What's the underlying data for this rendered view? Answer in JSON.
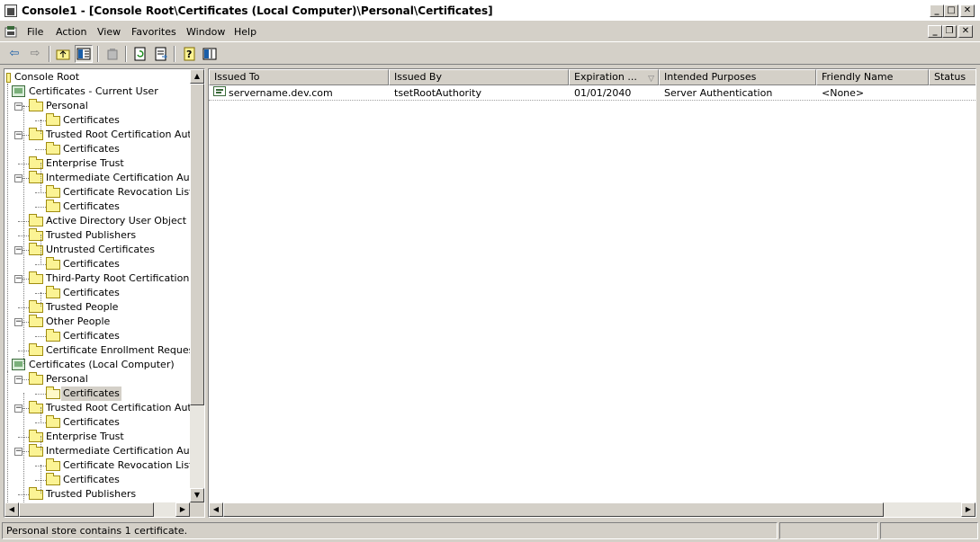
{
  "window": {
    "title": "Console1 - [Console Root\\Certificates (Local Computer)\\Personal\\Certificates]"
  },
  "menubar": {
    "items": [
      "File",
      "Action",
      "View",
      "Favorites",
      "Window",
      "Help"
    ]
  },
  "toolbar": {
    "buttons": [
      "back-arrow-icon",
      "forward-arrow-icon",
      "up-folder-icon",
      "show-hide-tree-icon",
      "delete-icon",
      "refresh-icon",
      "export-list-icon",
      "help-icon",
      "action-pane-icon"
    ]
  },
  "tree": {
    "nodes": [
      {
        "label": "Console Root",
        "level": 0,
        "icon": "console-root-icon"
      },
      {
        "label": "Certificates - Current User",
        "level": 1,
        "icon": "certificate-store-icon"
      },
      {
        "label": "Personal",
        "level": 2,
        "icon": "folder-icon",
        "expander": "-"
      },
      {
        "label": "Certificates",
        "level": 3,
        "icon": "folder-icon"
      },
      {
        "label": "Trusted Root Certification Autho",
        "level": 2,
        "icon": "folder-icon",
        "expander": "-"
      },
      {
        "label": "Certificates",
        "level": 3,
        "icon": "folder-icon"
      },
      {
        "label": "Enterprise Trust",
        "level": 2,
        "icon": "folder-icon"
      },
      {
        "label": "Intermediate Certification Author",
        "level": 2,
        "icon": "folder-icon",
        "expander": "-"
      },
      {
        "label": "Certificate Revocation List",
        "level": 3,
        "icon": "folder-icon"
      },
      {
        "label": "Certificates",
        "level": 3,
        "icon": "folder-icon"
      },
      {
        "label": "Active Directory User Object",
        "level": 2,
        "icon": "folder-icon"
      },
      {
        "label": "Trusted Publishers",
        "level": 2,
        "icon": "folder-icon"
      },
      {
        "label": "Untrusted Certificates",
        "level": 2,
        "icon": "folder-icon",
        "expander": "-"
      },
      {
        "label": "Certificates",
        "level": 3,
        "icon": "folder-icon"
      },
      {
        "label": "Third-Party Root Certification Au",
        "level": 2,
        "icon": "folder-icon",
        "expander": "-"
      },
      {
        "label": "Certificates",
        "level": 3,
        "icon": "folder-icon"
      },
      {
        "label": "Trusted People",
        "level": 2,
        "icon": "folder-icon"
      },
      {
        "label": "Other People",
        "level": 2,
        "icon": "folder-icon",
        "expander": "-"
      },
      {
        "label": "Certificates",
        "level": 3,
        "icon": "folder-icon"
      },
      {
        "label": "Certificate Enrollment Requests",
        "level": 2,
        "icon": "folder-icon"
      },
      {
        "label": "Certificates (Local Computer)",
        "level": 1,
        "icon": "certificate-store-icon"
      },
      {
        "label": "Personal",
        "level": 2,
        "icon": "folder-icon",
        "expander": "-"
      },
      {
        "label": "Certificates",
        "level": 3,
        "icon": "folder-open-icon",
        "selected": true
      },
      {
        "label": "Trusted Root Certification Autho",
        "level": 2,
        "icon": "folder-icon",
        "expander": "-"
      },
      {
        "label": "Certificates",
        "level": 3,
        "icon": "folder-icon"
      },
      {
        "label": "Enterprise Trust",
        "level": 2,
        "icon": "folder-icon"
      },
      {
        "label": "Intermediate Certification Author",
        "level": 2,
        "icon": "folder-icon",
        "expander": "-"
      },
      {
        "label": "Certificate Revocation List",
        "level": 3,
        "icon": "folder-icon"
      },
      {
        "label": "Certificates",
        "level": 3,
        "icon": "folder-icon"
      },
      {
        "label": "Trusted Publishers",
        "level": 2,
        "icon": "folder-icon"
      }
    ]
  },
  "list": {
    "columns": [
      "Issued To",
      "Issued By",
      "Expiration ...",
      "Intended Purposes",
      "Friendly Name",
      "Status"
    ],
    "rows": [
      {
        "issued_to": "servername.dev.com",
        "issued_by": "tsetRootAuthority",
        "expiration": "01/01/2040",
        "intended_purposes": "Server Authentication",
        "friendly_name": "<None>",
        "status": ""
      }
    ]
  },
  "statusbar": {
    "text": "Personal store contains 1 certificate."
  }
}
